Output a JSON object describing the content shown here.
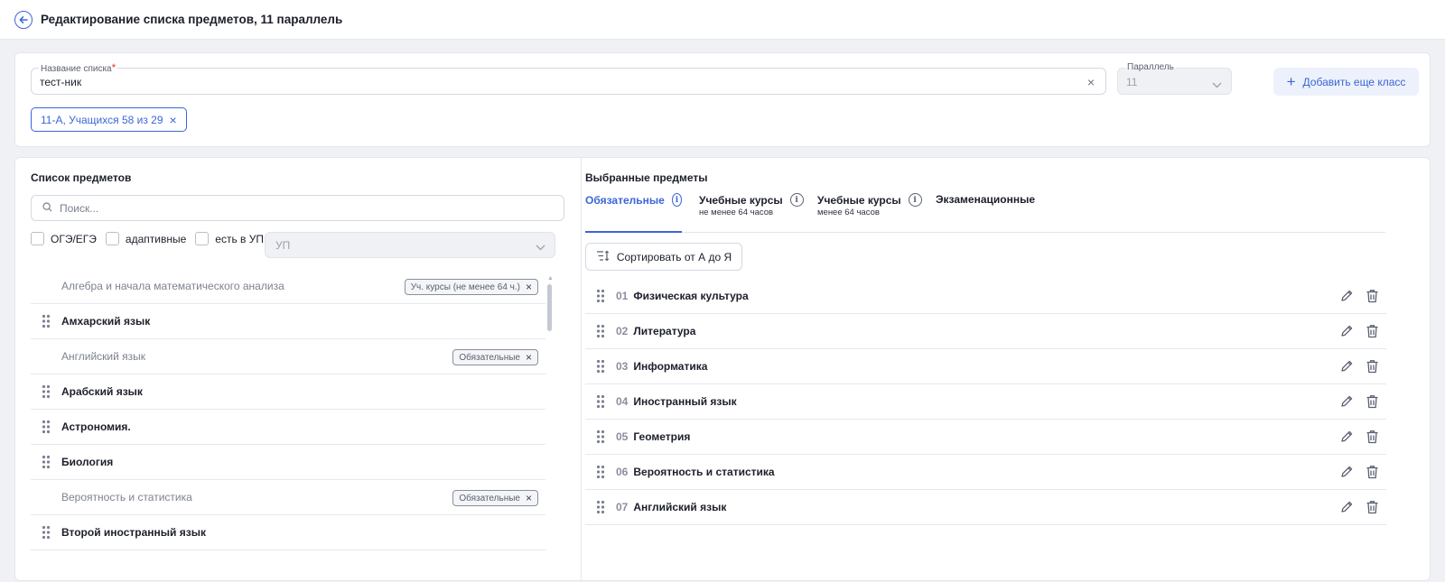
{
  "header": {
    "title": "Редактирование списка предметов, 11 параллель"
  },
  "form": {
    "list_name_label": "Название списка",
    "required_mark": "*",
    "list_name_value": "тест-ник",
    "clear_symbol": "×",
    "parallel_label": "Параллель",
    "parallel_value": "11",
    "add_class_label": "Добавить еще класс",
    "add_class_symbol": "+",
    "class_chip": "11-А, Учащихся 58 из 29",
    "class_chip_remove": "×"
  },
  "left": {
    "title": "Список предметов",
    "search_placeholder": "Поиск...",
    "filters": {
      "oge": "ОГЭ/ЕГЭ",
      "adaptive": "адаптивные",
      "in_up": "есть в УП"
    },
    "up_select": "УП",
    "subjects": [
      {
        "name": "Алгебра и начала математического анализа",
        "state": "added",
        "tag": "Уч. курсы (не менее 64 ч.)"
      },
      {
        "name": "Амхарский язык",
        "state": "avail",
        "tag": ""
      },
      {
        "name": "Английский язык",
        "state": "added",
        "tag": "Обязательные"
      },
      {
        "name": "Арабский язык",
        "state": "avail",
        "tag": ""
      },
      {
        "name": "Астрономия.",
        "state": "avail",
        "tag": ""
      },
      {
        "name": "Биология",
        "state": "avail",
        "tag": ""
      },
      {
        "name": "Вероятность и статистика",
        "state": "added",
        "tag": "Обязательные"
      },
      {
        "name": "Второй иностранный язык",
        "state": "avail",
        "tag": ""
      }
    ],
    "tag_remove": "×"
  },
  "right": {
    "title": "Выбранные предметы",
    "tabs": [
      {
        "label": "Обязательные",
        "sub": ""
      },
      {
        "label": "Учебные курсы",
        "sub": "не менее 64 часов"
      },
      {
        "label": "Учебные курсы",
        "sub": "менее 64 часов"
      },
      {
        "label": "Экзаменационные",
        "sub": ""
      }
    ],
    "info_symbol": "i",
    "sort_label": "Сортировать от А до Я",
    "selected": [
      {
        "num": "01",
        "name": "Физическая культура"
      },
      {
        "num": "02",
        "name": "Литература"
      },
      {
        "num": "03",
        "name": "Информатика"
      },
      {
        "num": "04",
        "name": "Иностранный язык"
      },
      {
        "num": "05",
        "name": "Геометрия"
      },
      {
        "num": "06",
        "name": "Вероятность и статистика"
      },
      {
        "num": "07",
        "name": "Английский язык"
      }
    ]
  },
  "colors": {
    "accent": "#3a66d8",
    "text": "#1c1f2b",
    "muted": "#7d8290",
    "border": "#e3e6ec",
    "background": "#eff1f5",
    "required": "#e23b3b"
  },
  "icons": {
    "back": "arrow-left-circle-icon",
    "clear": "close-icon",
    "chevron": "chevron-down-icon",
    "add": "plus-icon",
    "search": "search-icon",
    "drag": "drag-handle-icon",
    "info": "info-icon",
    "sort": "sort-icon",
    "edit": "pencil-icon",
    "delete": "trash-icon"
  }
}
